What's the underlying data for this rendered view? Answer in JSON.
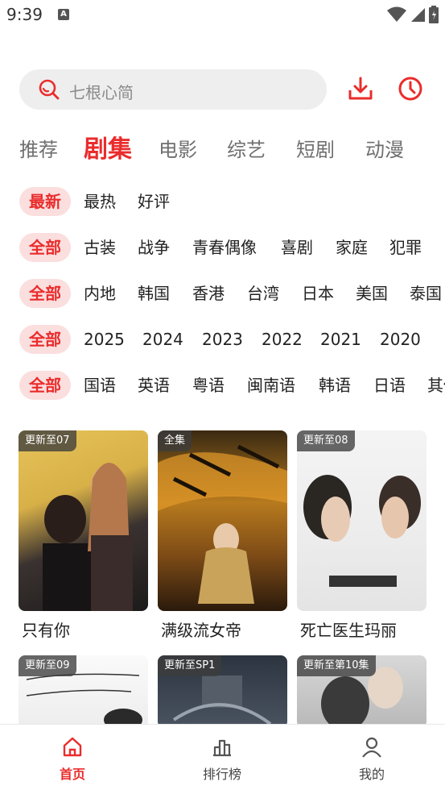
{
  "status_bar": {
    "time": "9:39",
    "notif_icon": "A"
  },
  "search": {
    "placeholder": "七根心简"
  },
  "tabs": [
    {
      "label": "推荐"
    },
    {
      "label": "剧集",
      "active": true
    },
    {
      "label": "电影"
    },
    {
      "label": "综艺"
    },
    {
      "label": "短剧"
    },
    {
      "label": "动漫"
    }
  ],
  "filters": {
    "sort": [
      "最新",
      "最热",
      "好评"
    ],
    "genre": [
      "全部",
      "古装",
      "战争",
      "青春偶像",
      "喜剧",
      "家庭",
      "犯罪"
    ],
    "region": [
      "全部",
      "内地",
      "韩国",
      "香港",
      "台湾",
      "日本",
      "美国",
      "泰国"
    ],
    "year": [
      "全部",
      "2025",
      "2024",
      "2023",
      "2022",
      "2021",
      "2020"
    ],
    "language": [
      "全部",
      "国语",
      "英语",
      "粤语",
      "闽南语",
      "韩语",
      "日语",
      "其他"
    ]
  },
  "cards": [
    {
      "badge": "更新至07",
      "title": "只有你"
    },
    {
      "badge": "全集",
      "title": "满级流女帝"
    },
    {
      "badge": "更新至08",
      "title": "死亡医生玛丽"
    },
    {
      "badge": "更新至09",
      "title": ""
    },
    {
      "badge": "更新至SP1",
      "title": ""
    },
    {
      "badge": "更新至第10集",
      "title": ""
    }
  ],
  "bottom_nav": [
    {
      "label": "首页",
      "icon": "home-icon",
      "active": true
    },
    {
      "label": "排行榜",
      "icon": "ranking-icon"
    },
    {
      "label": "我的",
      "icon": "profile-icon"
    }
  ],
  "colors": {
    "accent": "#ea2c2c",
    "chip_bg": "#fbdede",
    "search_bg": "#eeeeee"
  }
}
